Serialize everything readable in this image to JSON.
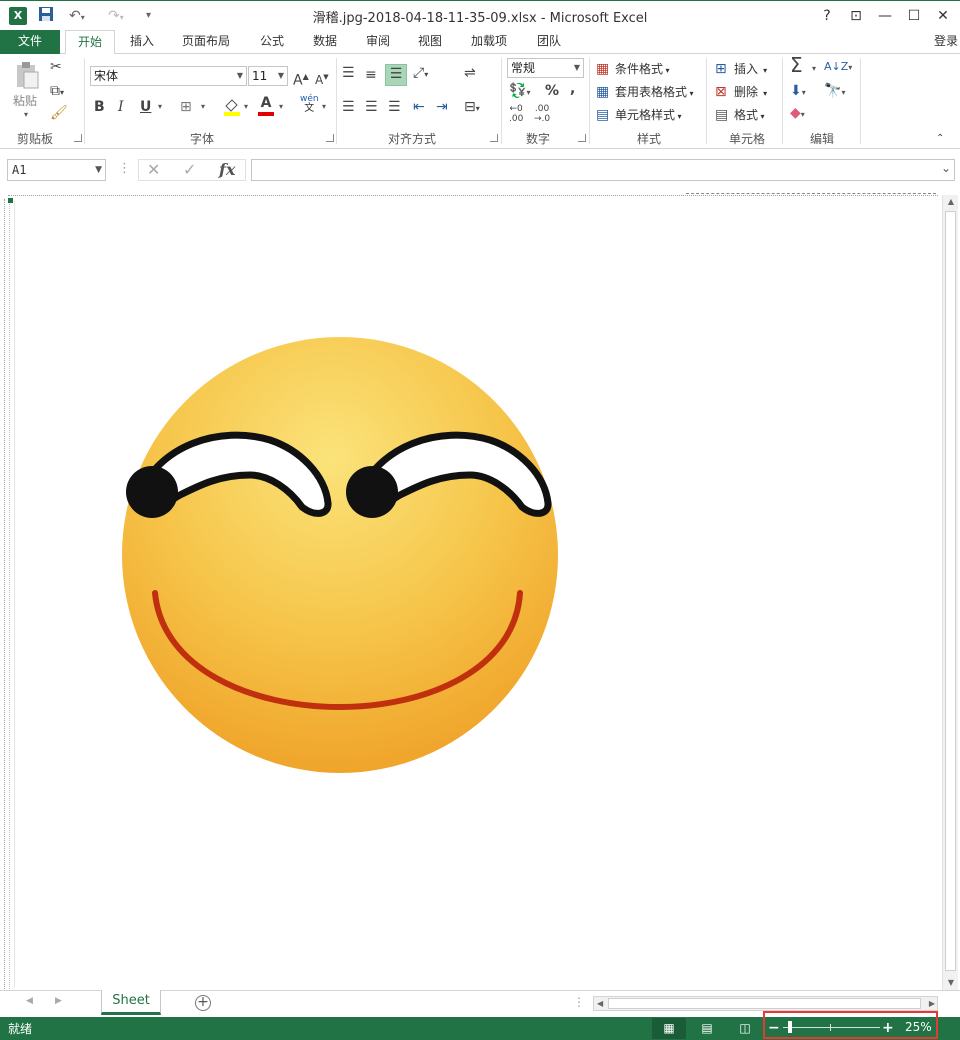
{
  "window": {
    "title": "滑稽.jpg-2018-04-18-11-35-09.xlsx - Microsoft Excel",
    "app_icon": "excel-icon",
    "controls": {
      "help": "?",
      "restore_ribbon": "⊡",
      "minimize": "—",
      "maximize": "☐",
      "close": "✕"
    }
  },
  "quick_access": {
    "save": "save-icon",
    "undo": "undo-icon",
    "redo": "redo-icon",
    "customize": "customize-icon"
  },
  "tabs": [
    {
      "label": "文件"
    },
    {
      "label": "开始"
    },
    {
      "label": "插入"
    },
    {
      "label": "页面布局"
    },
    {
      "label": "公式"
    },
    {
      "label": "数据"
    },
    {
      "label": "审阅"
    },
    {
      "label": "视图"
    },
    {
      "label": "加载项"
    },
    {
      "label": "团队"
    }
  ],
  "active_tab": "开始",
  "login_label": "登录",
  "ribbon": {
    "clipboard": {
      "label": "剪贴板",
      "paste": "粘贴"
    },
    "font": {
      "label": "字体",
      "font_name": "宋体",
      "font_size": "11",
      "bold": "B",
      "italic": "I",
      "underline": "U",
      "grow": "A",
      "shrink": "A",
      "font_color": "A",
      "phonetic": "wén"
    },
    "alignment": {
      "label": "对齐方式"
    },
    "number": {
      "label": "数字",
      "format": "常规",
      "percent": "%",
      "comma": ","
    },
    "styles": {
      "label": "样式",
      "conditional": "条件格式",
      "table": "套用表格格式",
      "cell_styles": "单元格样式"
    },
    "cells": {
      "label": "单元格",
      "insert": "插入",
      "delete": "删除",
      "format": "格式"
    },
    "editing": {
      "label": "编辑",
      "sum": "Σ"
    }
  },
  "formula_bar": {
    "name_box": "A1",
    "fx": "fx",
    "value": ""
  },
  "sheets": [
    {
      "name": "Sheet",
      "active": true
    }
  ],
  "status": {
    "text": "就绪",
    "zoom": "25%",
    "zoom_percent": 25,
    "view": "normal"
  },
  "colors": {
    "brand": "#217346",
    "face_light": "#fbe37a",
    "face_dark": "#f0a42a",
    "smile": "#c0300f",
    "highlight_box": "#e53935"
  }
}
